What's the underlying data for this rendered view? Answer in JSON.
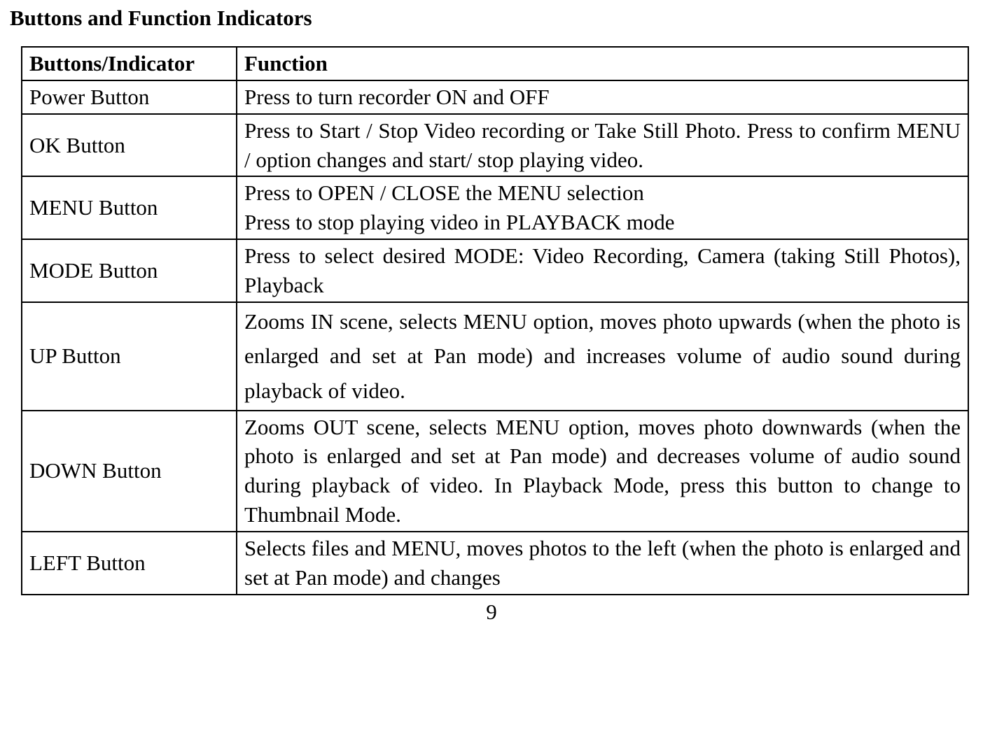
{
  "title": "Buttons and Function Indicators",
  "headers": {
    "a": "Buttons/Indicator",
    "b": "Function"
  },
  "rows": {
    "power": {
      "label": "Power Button",
      "desc": "Press to turn recorder ON and OFF"
    },
    "ok": {
      "label": "OK Button",
      "desc": "Press to Start / Stop Video recording or Take Still Photo. Press to confirm MENU / option changes and start/ stop playing video."
    },
    "menu": {
      "label": "MENU Button",
      "desc1": "Press to OPEN / CLOSE the MENU selection",
      "desc2": "Press to stop playing video in PLAYBACK mode"
    },
    "mode": {
      "label": "MODE Button",
      "desc": "Press to select desired MODE: Video Recording, Camera (taking Still Photos), Playback"
    },
    "up": {
      "label": "UP Button",
      "desc": "Zooms IN scene, selects MENU option, moves photo upwards (when the photo is enlarged and set at Pan mode) and increases volume of audio sound during playback of video."
    },
    "down": {
      "label": "DOWN Button",
      "desc": "Zooms OUT scene, selects MENU option, moves photo downwards (when the photo is enlarged and set at Pan mode) and decreases volume of audio sound during playback of video. In Playback Mode, press this button to change to Thumbnail Mode."
    },
    "left": {
      "label": "LEFT Button",
      "desc": "Selects files and MENU, moves photos to the left (when the photo is enlarged and set at Pan mode) and changes"
    }
  },
  "page_number": "9"
}
